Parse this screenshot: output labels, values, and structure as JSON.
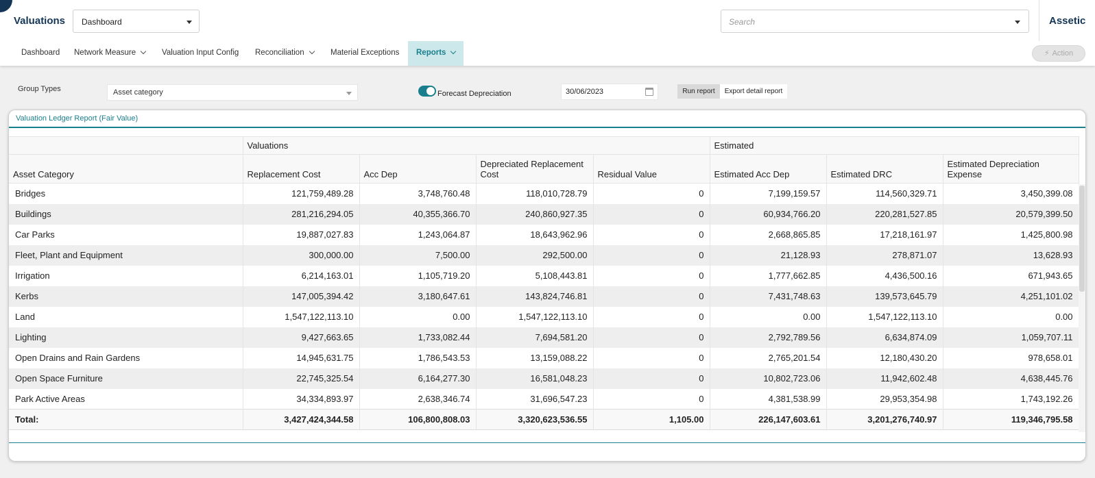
{
  "header": {
    "app_title": "Valuations",
    "dashboard_select": "Dashboard",
    "search_placeholder": "Search",
    "brand": "Assetic"
  },
  "nav": {
    "items": [
      "Dashboard",
      "Network Measure",
      "Valuation Input Config",
      "Reconciliation",
      "Material Exceptions",
      "Reports"
    ],
    "active": "Reports",
    "action_label": "Action"
  },
  "filters": {
    "group_types_label": "Group Types",
    "group_types_value": "Asset category",
    "forecast_label": "Forecast Depreciation",
    "forecast_on": true,
    "date": "30/06/2023",
    "run_label": "Run report",
    "export_label": "Export detail report"
  },
  "report": {
    "title": "Valuation Ledger Report (Fair Value)",
    "groups": {
      "valuations": "Valuations",
      "estimated": "Estimated"
    },
    "columns": [
      "Asset Category",
      "Replacement Cost",
      "Acc Dep",
      "Depreciated Replacement Cost",
      "Residual Value",
      "Estimated Acc Dep",
      "Estimated DRC",
      "Estimated Depreciation Expense"
    ],
    "rows": [
      [
        "Bridges",
        "121,759,489.28",
        "3,748,760.48",
        "118,010,728.79",
        "0",
        "7,199,159.57",
        "114,560,329.71",
        "3,450,399.08"
      ],
      [
        "Buildings",
        "281,216,294.05",
        "40,355,366.70",
        "240,860,927.35",
        "0",
        "60,934,766.20",
        "220,281,527.85",
        "20,579,399.50"
      ],
      [
        "Car Parks",
        "19,887,027.83",
        "1,243,064.87",
        "18,643,962.96",
        "0",
        "2,668,865.85",
        "17,218,161.97",
        "1,425,800.98"
      ],
      [
        "Fleet, Plant and Equipment",
        "300,000.00",
        "7,500.00",
        "292,500.00",
        "0",
        "21,128.93",
        "278,871.07",
        "13,628.93"
      ],
      [
        "Irrigation",
        "6,214,163.01",
        "1,105,719.20",
        "5,108,443.81",
        "0",
        "1,777,662.85",
        "4,436,500.16",
        "671,943.65"
      ],
      [
        "Kerbs",
        "147,005,394.42",
        "3,180,647.61",
        "143,824,746.81",
        "0",
        "7,431,748.63",
        "139,573,645.79",
        "4,251,101.02"
      ],
      [
        "Land",
        "1,547,122,113.10",
        "0.00",
        "1,547,122,113.10",
        "0",
        "0.00",
        "1,547,122,113.10",
        "0.00"
      ],
      [
        "Lighting",
        "9,427,663.65",
        "1,733,082.44",
        "7,694,581.20",
        "0",
        "2,792,789.56",
        "6,634,874.09",
        "1,059,707.11"
      ],
      [
        "Open Drains and Rain Gardens",
        "14,945,631.75",
        "1,786,543.53",
        "13,159,088.22",
        "0",
        "2,765,201.54",
        "12,180,430.20",
        "978,658.01"
      ],
      [
        "Open Space Furniture",
        "22,745,325.54",
        "6,164,277.30",
        "16,581,048.23",
        "0",
        "10,802,723.06",
        "11,942,602.48",
        "4,638,445.76"
      ],
      [
        "Park Active Areas",
        "34,334,893.97",
        "2,638,346.74",
        "31,696,547.23",
        "0",
        "4,381,538.99",
        "29,953,354.98",
        "1,743,192.26"
      ]
    ],
    "totals": [
      "Total:",
      "3,427,424,344.58",
      "106,800,808.03",
      "3,320,623,536.55",
      "1,105.00",
      "226,147,603.61",
      "3,201,276,740.97",
      "119,346,795.58"
    ]
  },
  "colors": {
    "brand": "#143556",
    "accent": "#1a7f8c",
    "active_tab_bg": "#cde8ea"
  },
  "icons": [
    "chevron-down-icon",
    "bolt-icon",
    "calendar-icon"
  ]
}
